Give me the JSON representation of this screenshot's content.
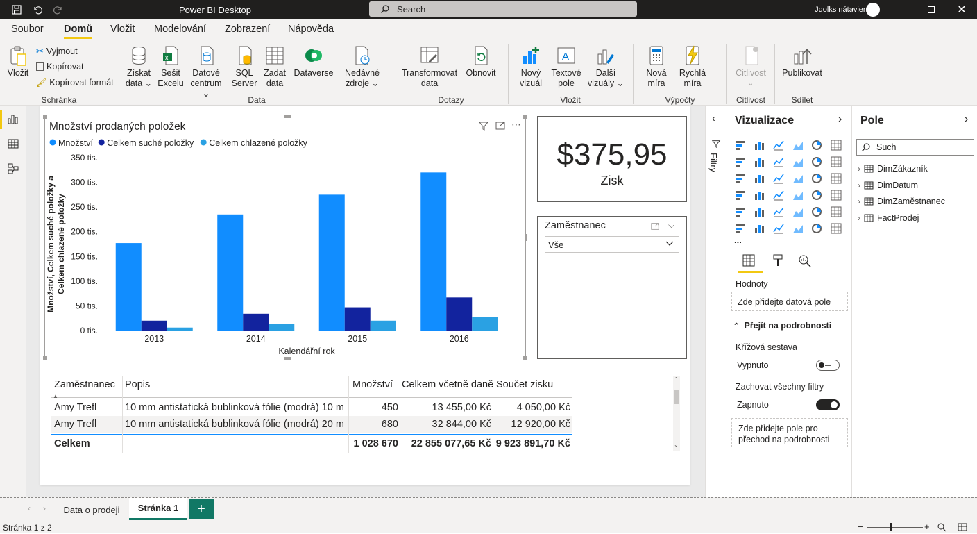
{
  "titlebar": {
    "app_title": "Power BI Desktop",
    "search_placeholder": "Search",
    "user": "Jdolks nátavien"
  },
  "menu": {
    "items": [
      "Soubor",
      "Domů",
      "Vložit",
      "Modelování",
      "Zobrazení",
      "Nápověda"
    ],
    "active": "Domů"
  },
  "ribbon": {
    "clipboard": {
      "paste": "Vložit",
      "cut": "Vyjmout",
      "copy": "Kopírovat",
      "format_painter": "Kopírovat formát",
      "group": "Schránka"
    },
    "data": {
      "get_data": [
        "Získat",
        "data ⌄"
      ],
      "excel": [
        "Sešit",
        "Excelu"
      ],
      "datahub": [
        "Datové",
        "centrum ⌄"
      ],
      "sql": [
        "SQL",
        "Server"
      ],
      "enter_data": [
        "Zadat",
        "data"
      ],
      "dataverse": "Dataverse",
      "recent": [
        "Nedávné",
        "zdroje ⌄"
      ],
      "group": "Data"
    },
    "queries": {
      "transform": [
        "Transformovat",
        "data"
      ],
      "refresh": "Obnovit",
      "group": "Dotazy"
    },
    "insert": {
      "new_visual": [
        "Nový",
        "vizuál"
      ],
      "text_box": [
        "Textové",
        "pole"
      ],
      "more_visuals": [
        "Další",
        "vizuály ⌄"
      ],
      "group": "Vložit"
    },
    "calculations": {
      "new_measure": [
        "Nová",
        "míra"
      ],
      "quick_measure": [
        "Rychlá",
        "míra"
      ],
      "group": "Výpočty"
    },
    "sensitivity": {
      "label": "Citlivost",
      "group": "Citlivost"
    },
    "share": {
      "publish": "Publikovat",
      "group": "Sdílet"
    }
  },
  "chart_data": {
    "type": "bar",
    "title": "Množství prodaných položek",
    "categories": [
      "2013",
      "2014",
      "2015",
      "2016"
    ],
    "series": [
      {
        "name": "Množství",
        "values": [
          177000,
          235000,
          275000,
          320000
        ],
        "color": "#118dff"
      },
      {
        "name": "Celkem suché položky",
        "values": [
          20000,
          34000,
          47000,
          67000
        ],
        "color": "#12239e"
      },
      {
        "name": "Celkem chlazené položky",
        "values": [
          6000,
          14000,
          20000,
          28000
        ],
        "color": "#2aa1e3"
      }
    ],
    "xlabel": "Kalendářní rok",
    "ylabel": [
      "Množství, Celkem suché položky a",
      "Celkem chlazené položky"
    ],
    "ylim": [
      0,
      350000
    ],
    "yticks": [
      0,
      50000,
      100000,
      150000,
      200000,
      250000,
      300000,
      350000
    ],
    "ytick_labels": [
      "0 tis.",
      "50 tis.",
      "100 tis.",
      "150 tis.",
      "200 tis.",
      "250 tis.",
      "300 tis.",
      "350 tis."
    ],
    "legend": "top-left",
    "grid": false
  },
  "kpi": {
    "value": "$375,95",
    "label": "Zisk"
  },
  "slicer": {
    "title": "Zaměstnanec",
    "value": "Vše"
  },
  "table": {
    "headers": [
      "Zaměstnanec",
      "Popis",
      "Množství",
      "Celkem včetně daně",
      "Součet zisku"
    ],
    "rows": [
      [
        "Amy Trefl",
        "10 mm antistatická bublinková fólie (modrá) 10 m",
        "450",
        "13 455,00 Kč",
        "4 050,00 Kč"
      ],
      [
        "Amy Trefl",
        "10 mm antistatická bublinková fólie (modrá) 20 m",
        "680",
        "32 844,00 Kč",
        "12 920,00 Kč"
      ]
    ],
    "total": [
      "Celkem",
      "",
      "1 028 670",
      "22 855 077,65 Kč",
      "9 923 891,70 Kč"
    ]
  },
  "filters_pane": {
    "label": "Filtry"
  },
  "viz_pane": {
    "title": "Vizualizace",
    "more": "...",
    "values_label": "Hodnoty",
    "values_placeholder": "Zde přidejte datová pole",
    "drillthrough": "Přejít na podrobnosti",
    "cross_report": "Křížová sestava",
    "cross_report_state": "Vypnuto",
    "keep_filters": "Zachovat všechny filtry",
    "keep_filters_state": "Zapnuto",
    "drill_placeholder": "Zde přidejte pole pro přechod na podrobnosti"
  },
  "fields_pane": {
    "title": "Pole",
    "search_placeholder": "Such",
    "tables": [
      "DimZákazník",
      "DimDatum",
      "DimZaměstnanec",
      "FactProdej"
    ]
  },
  "tabs": {
    "items": [
      "Data o prodeji",
      "Stránka 1"
    ],
    "active": "Stránka 1",
    "add": "+"
  },
  "status": {
    "page": "Stránka 1 z 2"
  },
  "colors": {
    "accent": "#f2c811",
    "brand_green": "#117865",
    "series1": "#118dff",
    "series2": "#12239e",
    "series3": "#2aa1e3"
  }
}
